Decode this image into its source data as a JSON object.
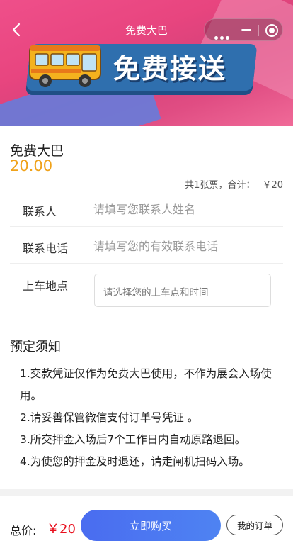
{
  "navbar": {
    "title": "免费大巴"
  },
  "banner": {
    "text": "免费接送"
  },
  "product": {
    "name": "免费大巴",
    "price": "20.00"
  },
  "summary": {
    "tickets": "共1张票，合计：",
    "amount": "￥20"
  },
  "form": {
    "contact_label": "联系人",
    "contact_placeholder": "请填写您联系人姓名",
    "phone_label": "联系电话",
    "phone_placeholder": "请填写您的有效联系电话",
    "pickup_label": "上车地点",
    "pickup_placeholder": "请选择您的上车点和时间"
  },
  "notice": {
    "title": "预定须知",
    "items": [
      "1.交款凭证仅作为免费大巴使用，不作为展会入场使用。",
      "2.请妥善保管微信支付订单号凭证 。",
      "3.所交押金入场后7个工作日内自动原路退回。",
      "4.为使您的押金及时退还，请走闸机扫码入场。"
    ]
  },
  "bottom": {
    "total_label": "总价:",
    "total_value": "￥20",
    "buy_label": "立即购买",
    "orders_label": "我的订单"
  },
  "colors": {
    "price": "#f0a21a",
    "total": "#e8101e",
    "button": "#4a6cf0"
  }
}
